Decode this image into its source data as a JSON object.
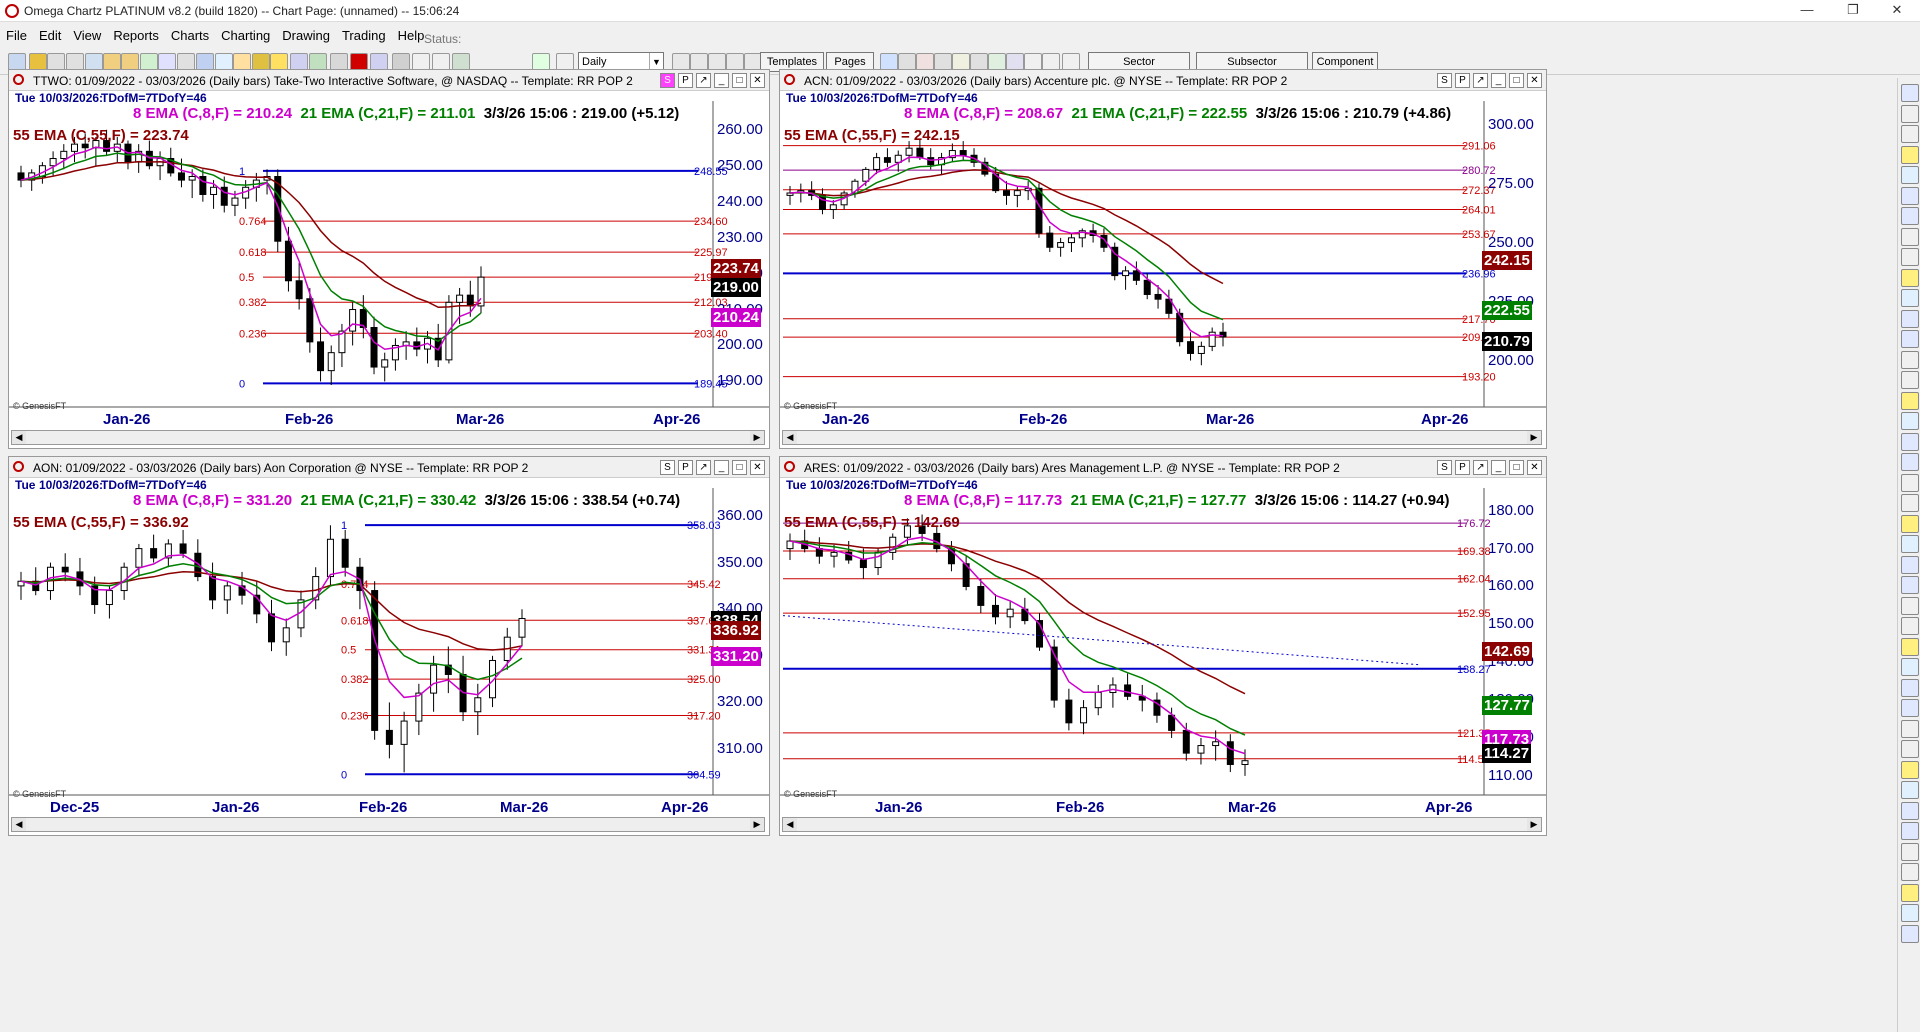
{
  "window": {
    "title": "Omega Chartz PLATINUM v8.2 (build 1820)  --  Chart Page: (unnamed) -- 15:06:24",
    "status_label": "Status:"
  },
  "menu": [
    "File",
    "Edit",
    "View",
    "Reports",
    "Charts",
    "Charting",
    "Drawing",
    "Trading",
    "Help"
  ],
  "toolbar": {
    "period": "Daily",
    "templates": "Templates",
    "pages": "Pages",
    "sector": "Sector",
    "subsector": "Subsector",
    "component": "Component"
  },
  "date_row": {
    "day": "Tue",
    "date": "10/03/2026:",
    "tdofm": "TDofM=7",
    "tdofy": "TDofY=46"
  },
  "panels": [
    {
      "id": "ttwo",
      "header": "TTWO:  01/09/2022 - 03/03/2026  (Daily bars)   Take-Two Interactive Software, @ NASDAQ  --  Template: RR POP 2",
      "ema8": "8 EMA (C,8,F) = 210.24",
      "ema21": "21 EMA (C,21,F) = 211.01",
      "last": "3/3/26 15:06 : 219.00 (+5.12)",
      "ema55": "55 EMA (C,55,F) = 223.74",
      "yticks": [
        "260.00",
        "250.00",
        "240.00",
        "230.00",
        "220.00",
        "210.00",
        "200.00",
        "190.00"
      ],
      "xticks": [
        "Jan-26",
        "Feb-26",
        "Mar-26",
        "Apr-26"
      ],
      "levels": [
        {
          "price": "248.55",
          "fib": "1",
          "color": "#0000cc"
        },
        {
          "price": "234.60",
          "fib": "0.764",
          "color": "#cc0000"
        },
        {
          "price": "225.97",
          "fib": "0.618",
          "color": "#cc0000"
        },
        {
          "price": "219.00",
          "fib": "0.5",
          "color": "#cc0000"
        },
        {
          "price": "212.03",
          "fib": "0.382",
          "color": "#cc0000"
        },
        {
          "price": "203.40",
          "fib": "0.236",
          "color": "#cc0000"
        },
        {
          "price": "189.45",
          "fib": "0",
          "color": "#0000cc"
        }
      ],
      "boxes": [
        {
          "text": "223.74",
          "color": "#8b0000"
        },
        {
          "text": "219.00",
          "color": "#000000"
        },
        {
          "text": "210.24",
          "color": "#cc00cc"
        }
      ],
      "credit": "© GenesisFT"
    },
    {
      "id": "acn",
      "header": "ACN:  01/09/2022 - 03/03/2026  (Daily bars)   Accenture plc. @ NYSE  --  Template: RR POP 2",
      "ema8": "8 EMA (C,8,F) = 208.67",
      "ema21": "21 EMA (C,21,F) = 222.55",
      "last": "3/3/26 15:06 : 210.79 (+4.86)",
      "ema55": "55 EMA (C,55,F) = 242.15",
      "yticks": [
        "300.00",
        "275.00",
        "250.00",
        "225.00",
        "200.00"
      ],
      "xticks": [
        "Jan-26",
        "Feb-26",
        "Mar-26",
        "Apr-26"
      ],
      "levels": [
        {
          "price": "291.06",
          "color": "#cc0000"
        },
        {
          "price": "280.72",
          "color": "#8b008b"
        },
        {
          "price": "272.37",
          "color": "#cc0000"
        },
        {
          "price": "264.01",
          "color": "#cc0000"
        },
        {
          "price": "253.67",
          "color": "#cc0000"
        },
        {
          "price": "236.96",
          "color": "#0000cc"
        },
        {
          "price": "217.70",
          "color": "#cc0000"
        },
        {
          "price": "209.91",
          "color": "#cc0000"
        },
        {
          "price": "193.20",
          "color": "#cc0000"
        }
      ],
      "boxes": [
        {
          "text": "242.15",
          "color": "#8b0000"
        },
        {
          "text": "222.55",
          "color": "#008000"
        },
        {
          "text": "210.79",
          "color": "#000000"
        }
      ],
      "credit": "© GenesisFT"
    },
    {
      "id": "aon",
      "header": "AON:  01/09/2022 - 03/03/2026  (Daily bars)   Aon Corporation @ NYSE  --  Template: RR POP 2",
      "ema8": "8 EMA (C,8,F) = 331.20",
      "ema21": "21 EMA (C,21,F) = 330.42",
      "last": "3/3/26 15:06 : 338.54 (+0.74)",
      "ema55": "55 EMA (C,55,F) = 336.92",
      "yticks": [
        "360.00",
        "350.00",
        "340.00",
        "330.00",
        "320.00",
        "310.00"
      ],
      "xticks": [
        "Dec-25",
        "Jan-26",
        "Feb-26",
        "Mar-26",
        "Apr-26"
      ],
      "levels": [
        {
          "price": "358.03",
          "fib": "1",
          "color": "#0000cc"
        },
        {
          "price": "345.42",
          "fib": "0.764",
          "color": "#cc0000"
        },
        {
          "price": "337.62",
          "fib": "0.618",
          "color": "#cc0000"
        },
        {
          "price": "331.31",
          "fib": "0.5",
          "color": "#cc0000"
        },
        {
          "price": "325.00",
          "fib": "0.382",
          "color": "#cc0000"
        },
        {
          "price": "317.20",
          "fib": "0.236",
          "color": "#cc0000"
        },
        {
          "price": "304.59",
          "fib": "0",
          "color": "#0000cc"
        }
      ],
      "boxes": [
        {
          "text": "338.54",
          "color": "#000000"
        },
        {
          "text": "336.92",
          "color": "#8b0000"
        },
        {
          "text": "331.20",
          "color": "#cc00cc"
        }
      ],
      "credit": "© GenesisFT"
    },
    {
      "id": "ares",
      "header": "ARES:  01/09/2022 - 03/03/2026  (Daily bars)   Ares Management L.P. @ NYSE  --  Template: RR POP 2",
      "ema8": "8 EMA (C,8,F) = 117.73",
      "ema21": "21 EMA (C,21,F) = 127.77",
      "last": "3/3/26 15:06 : 114.27 (+0.94)",
      "ema55": "55 EMA (C,55,F) = 142.69",
      "yticks": [
        "180.00",
        "170.00",
        "160.00",
        "150.00",
        "140.00",
        "130.00",
        "120.00",
        "110.00"
      ],
      "xticks": [
        "Jan-26",
        "Feb-26",
        "Mar-26",
        "Apr-26"
      ],
      "levels": [
        {
          "price": "176.72",
          "color": "#8b008b"
        },
        {
          "price": "169.38",
          "color": "#cc0000"
        },
        {
          "price": "162.04",
          "color": "#cc0000"
        },
        {
          "price": "152.95",
          "color": "#cc0000"
        },
        {
          "price": "138.27",
          "color": "#0000cc"
        },
        {
          "price": "121.35",
          "color": "#cc0000"
        },
        {
          "price": "114.50",
          "color": "#cc0000"
        }
      ],
      "boxes": [
        {
          "text": "142.69",
          "color": "#8b0000"
        },
        {
          "text": "127.77",
          "color": "#008000"
        },
        {
          "text": "117.73",
          "color": "#cc00cc"
        },
        {
          "text": "114.27",
          "color": "#000000"
        }
      ],
      "credit": "© GenesisFT"
    }
  ]
}
